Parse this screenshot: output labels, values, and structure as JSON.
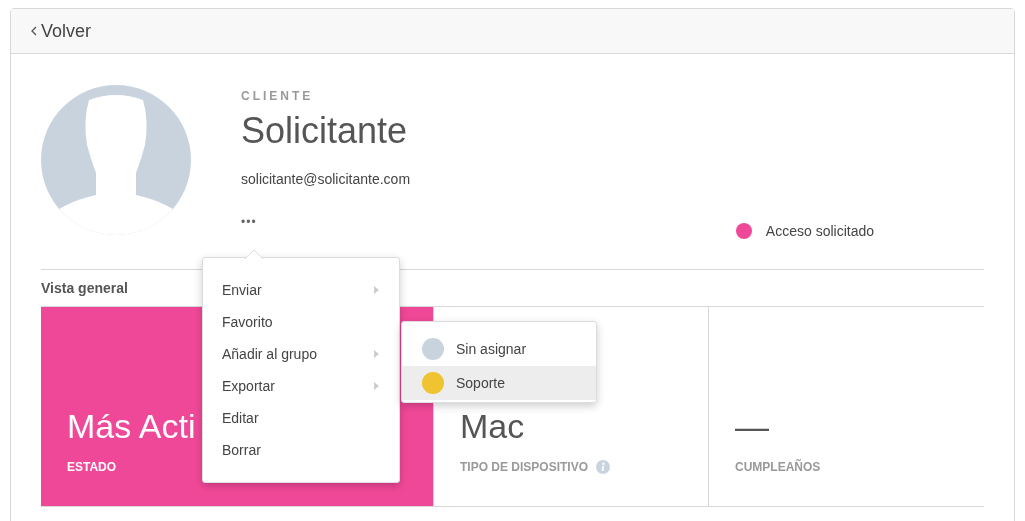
{
  "back_link": {
    "label": "Volver"
  },
  "profile": {
    "role": "CLIENTE",
    "name": "Solicitante",
    "email": "solicitante@solicitante.com",
    "more_button": "•••",
    "status": {
      "label": "Acceso solicitado",
      "color": "#f04898"
    }
  },
  "overview": {
    "title": "Vista general",
    "cards": [
      {
        "value": "Más Acti",
        "label": "ESTADO",
        "highlighted": true,
        "info": false
      },
      {
        "value": "Mac",
        "label": "TIPO DE DISPOSITIVO",
        "highlighted": false,
        "info": true
      },
      {
        "value": "—",
        "label": "CUMPLEAÑOS",
        "highlighted": false,
        "info": false
      }
    ]
  },
  "menu": {
    "items": [
      {
        "label": "Enviar",
        "submenu": true
      },
      {
        "label": "Favorito",
        "submenu": false
      },
      {
        "label": "Añadir al grupo",
        "submenu": true
      },
      {
        "label": "Exportar",
        "submenu": true
      },
      {
        "label": "Editar",
        "submenu": false
      },
      {
        "label": "Borrar",
        "submenu": false
      }
    ]
  },
  "submenu": {
    "items": [
      {
        "label": "Sin asignar",
        "color": "#c9d3de",
        "selected": false
      },
      {
        "label": "Soporte",
        "color": "#f0c330",
        "selected": true
      }
    ]
  }
}
